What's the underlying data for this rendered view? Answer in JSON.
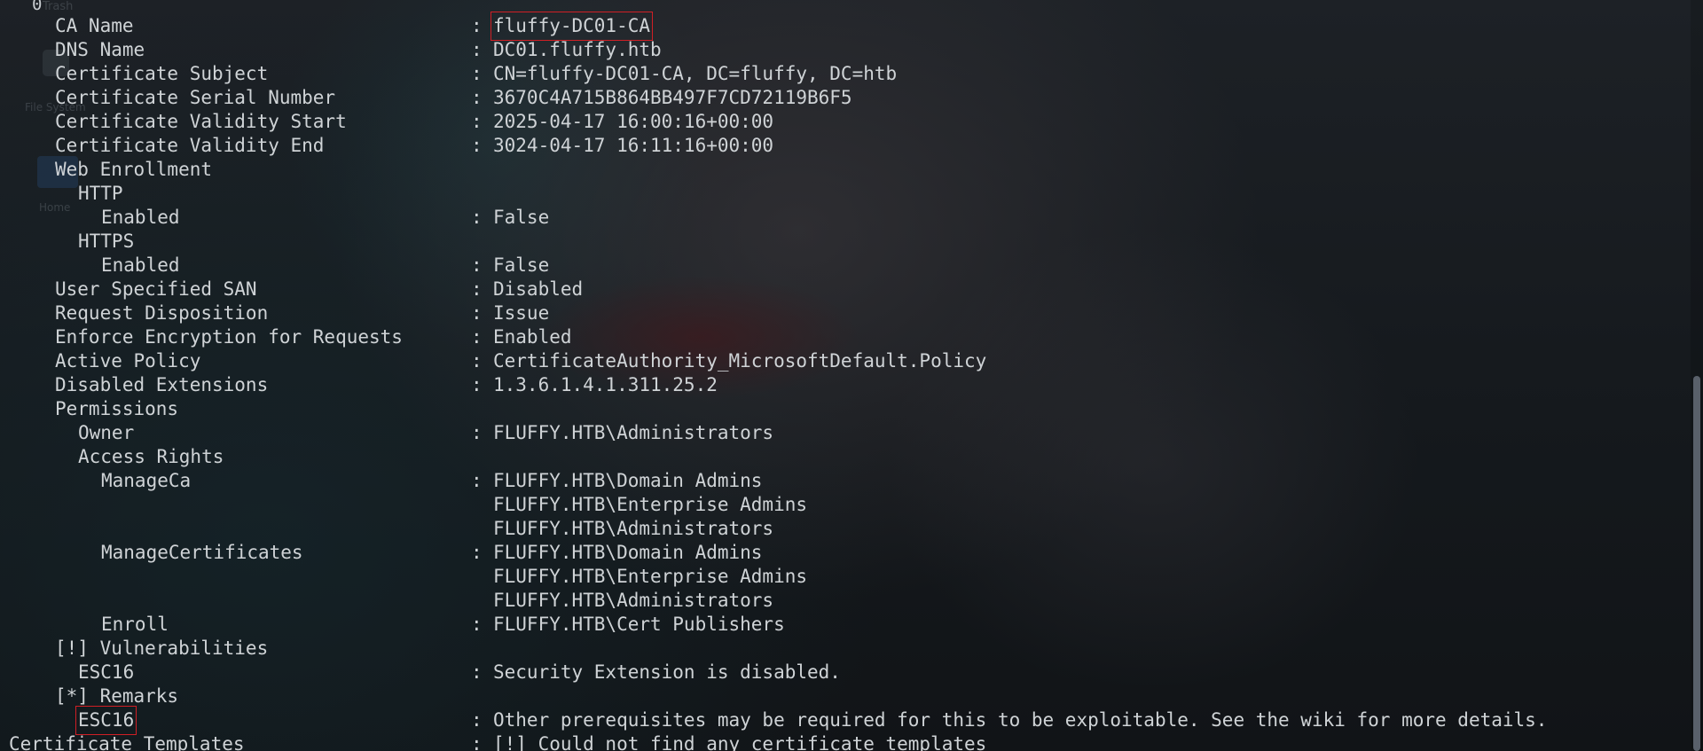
{
  "terminal": {
    "rows": [
      {
        "key": "CA Name",
        "value": "fluffy-DC01-CA"
      },
      {
        "key": "DNS Name",
        "value": "DC01.fluffy.htb"
      },
      {
        "key": "Certificate Subject",
        "value": "CN=fluffy-DC01-CA, DC=fluffy, DC=htb"
      },
      {
        "key": "Certificate Serial Number",
        "value": "3670C4A715B864BB497F7CD72119B6F5"
      },
      {
        "key": "Certificate Validity Start",
        "value": "2025-04-17 16:00:16+00:00"
      },
      {
        "key": "Certificate Validity End",
        "value": "3024-04-17 16:11:16+00:00"
      },
      {
        "key": "Web Enrollment",
        "value": ""
      },
      {
        "key": "HTTP",
        "value": ""
      },
      {
        "key": "Enabled",
        "value": "False"
      },
      {
        "key": "HTTPS",
        "value": ""
      },
      {
        "key": "Enabled",
        "value": "False"
      },
      {
        "key": "User Specified SAN",
        "value": "Disabled"
      },
      {
        "key": "Request Disposition",
        "value": "Issue"
      },
      {
        "key": "Enforce Encryption for Requests",
        "value": "Enabled"
      },
      {
        "key": "Active Policy",
        "value": "CertificateAuthority_MicrosoftDefault.Policy"
      },
      {
        "key": "Disabled Extensions",
        "value": "1.3.6.1.4.1.311.25.2"
      },
      {
        "key": "Permissions",
        "value": ""
      },
      {
        "key": "Owner",
        "value": "FLUFFY.HTB\\Administrators"
      },
      {
        "key": "Access Rights",
        "value": ""
      },
      {
        "key": "ManageCa",
        "value": "FLUFFY.HTB\\Domain Admins"
      },
      {
        "key": "",
        "value": "FLUFFY.HTB\\Enterprise Admins"
      },
      {
        "key": "",
        "value": "FLUFFY.HTB\\Administrators"
      },
      {
        "key": "ManageCertificates",
        "value": "FLUFFY.HTB\\Domain Admins"
      },
      {
        "key": "",
        "value": "FLUFFY.HTB\\Enterprise Admins"
      },
      {
        "key": "",
        "value": "FLUFFY.HTB\\Administrators"
      },
      {
        "key": "Enroll",
        "value": "FLUFFY.HTB\\Cert Publishers"
      },
      {
        "key": "[!] Vulnerabilities",
        "value": ""
      },
      {
        "key": "ESC16",
        "value": "Security Extension is disabled."
      },
      {
        "key": "[*] Remarks",
        "value": ""
      },
      {
        "key": "ESC16",
        "value": "Other prerequisites may be required for this to be exploitable. See the wiki for more details."
      },
      {
        "key": "Certificate Templates",
        "value": "[!] Could not find any certificate templates"
      }
    ],
    "separator": ":",
    "top_cursor": "0"
  },
  "desktop": {
    "trash_label": "Trash",
    "file_system_label": "File System",
    "home_label": "Home"
  },
  "colors": {
    "text": "#cfd3d6",
    "highlight_box": "#d01f25"
  }
}
